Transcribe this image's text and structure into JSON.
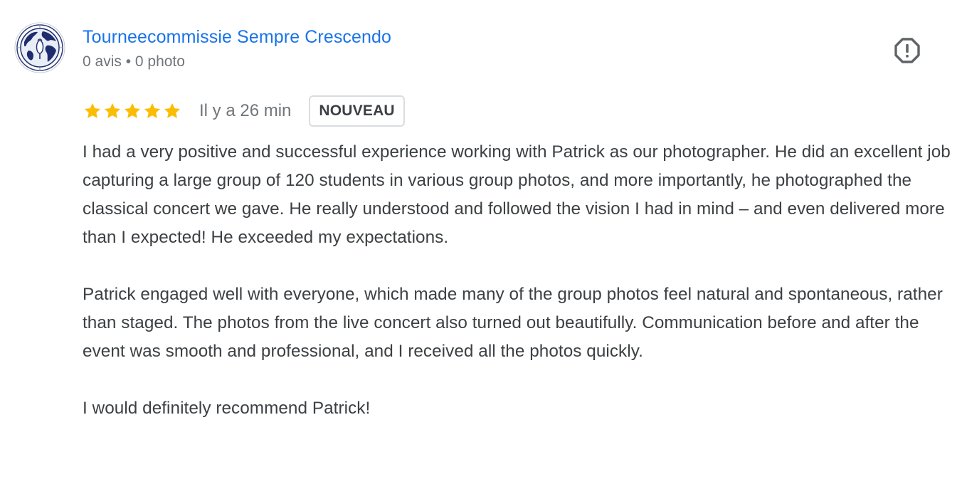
{
  "reviewer": {
    "name": "Tourneecommissie Sempre Crescendo",
    "meta": "0 avis • 0 photo"
  },
  "review": {
    "rating": 5,
    "max_rating": 5,
    "time": "Il y a 26 min",
    "badge": "NOUVEAU",
    "paragraphs": [
      "I had a very positive and successful experience working with Patrick as our photographer. He did an excellent job capturing a large group of 120 students in various group photos, and more importantly, he photographed the classical concert we gave. He really understood and followed the vision I had in mind – and even delivered more than I expected! He exceeded my expectations.",
      "Patrick engaged well with everyone, which made many of the group photos feel natural and spontaneous, rather than staged. The photos from the live concert also turned out beautifully. Communication before and after the event was smooth and professional, and I received all the photos quickly.",
      "I would definitely recommend Patrick!"
    ]
  },
  "icons": {
    "avatar": "globe-logo-icon",
    "report": "report-flag-icon",
    "star": "star-icon"
  },
  "colors": {
    "name_link": "#1a73e8",
    "star": "#fbbc04",
    "secondary_text": "#70757a",
    "body_text": "#3c4043",
    "badge_border": "#dadce0"
  }
}
